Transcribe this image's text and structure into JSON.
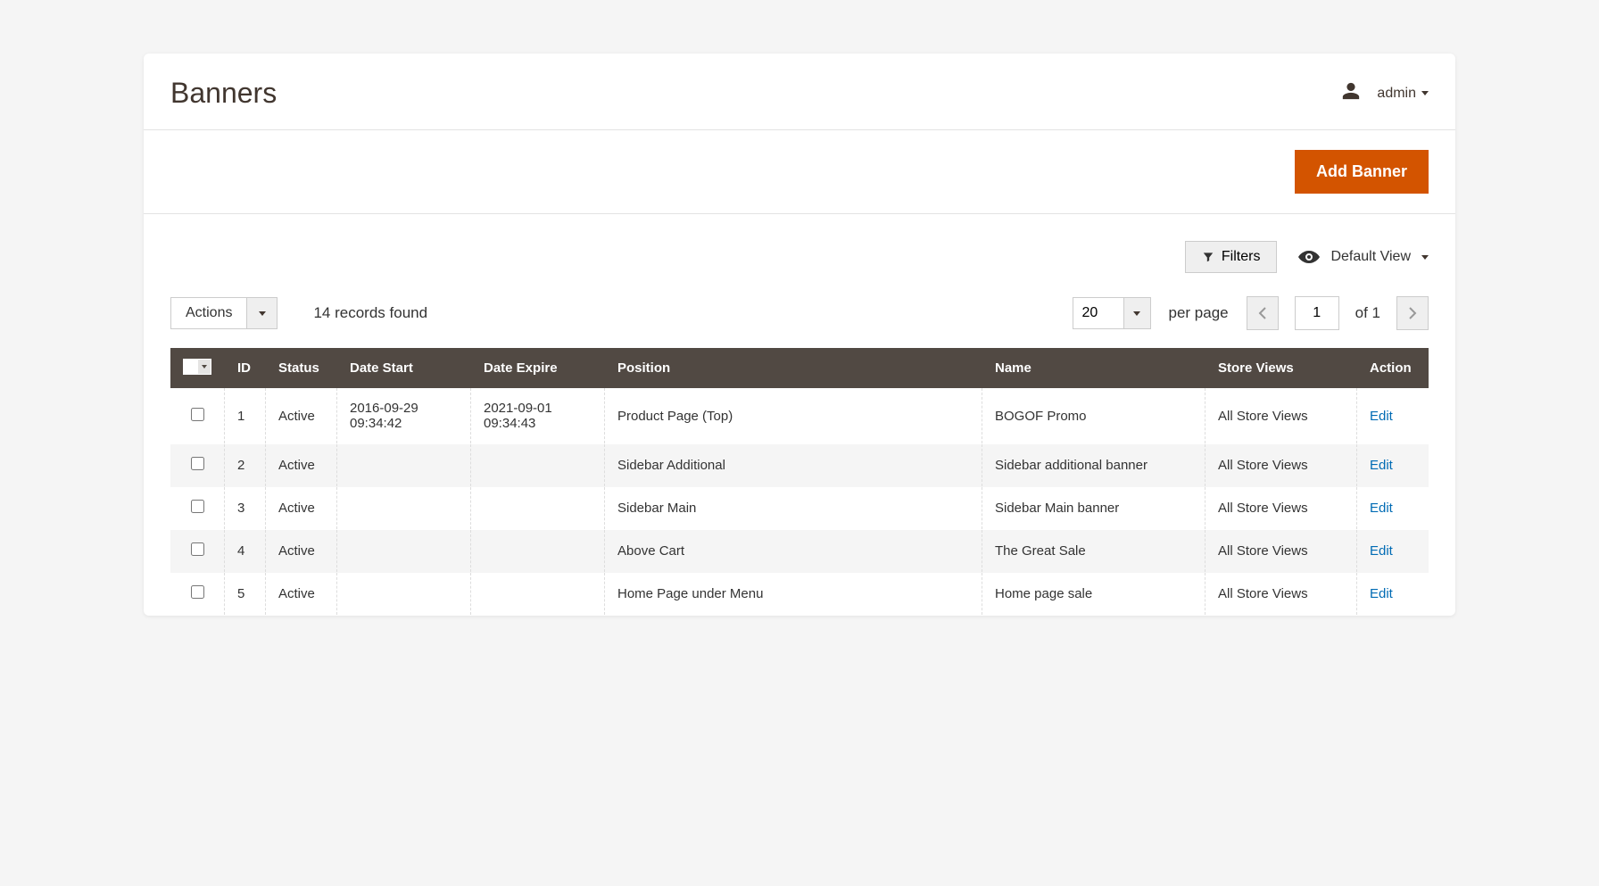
{
  "header": {
    "title": "Banners",
    "username": "admin"
  },
  "toolbar": {
    "add_label": "Add Banner"
  },
  "controls": {
    "filters_label": "Filters",
    "view_label": "Default View",
    "actions_label": "Actions",
    "records_found": "14 records found",
    "page_size": "20",
    "per_page_label": "per page",
    "current_page": "1",
    "total_pages_label": "of 1"
  },
  "table": {
    "headers": {
      "id": "ID",
      "status": "Status",
      "date_start": "Date Start",
      "date_expire": "Date Expire",
      "position": "Position",
      "name": "Name",
      "store_views": "Store Views",
      "action": "Action"
    },
    "edit_label": "Edit",
    "rows": [
      {
        "id": "1",
        "status": "Active",
        "date_start": "2016-09-29 09:34:42",
        "date_expire": "2021-09-01 09:34:43",
        "position": "Product Page (Top)",
        "name": "BOGOF Promo",
        "store_views": "All Store Views"
      },
      {
        "id": "2",
        "status": "Active",
        "date_start": "",
        "date_expire": "",
        "position": "Sidebar Additional",
        "name": "Sidebar additional banner",
        "store_views": "All Store Views"
      },
      {
        "id": "3",
        "status": "Active",
        "date_start": "",
        "date_expire": "",
        "position": "Sidebar Main",
        "name": "Sidebar Main banner",
        "store_views": "All Store Views"
      },
      {
        "id": "4",
        "status": "Active",
        "date_start": "",
        "date_expire": "",
        "position": "Above Cart",
        "name": "The Great Sale",
        "store_views": "All Store Views"
      },
      {
        "id": "5",
        "status": "Active",
        "date_start": "",
        "date_expire": "",
        "position": "Home Page under Menu",
        "name": "Home page sale",
        "store_views": "All Store Views"
      }
    ]
  }
}
